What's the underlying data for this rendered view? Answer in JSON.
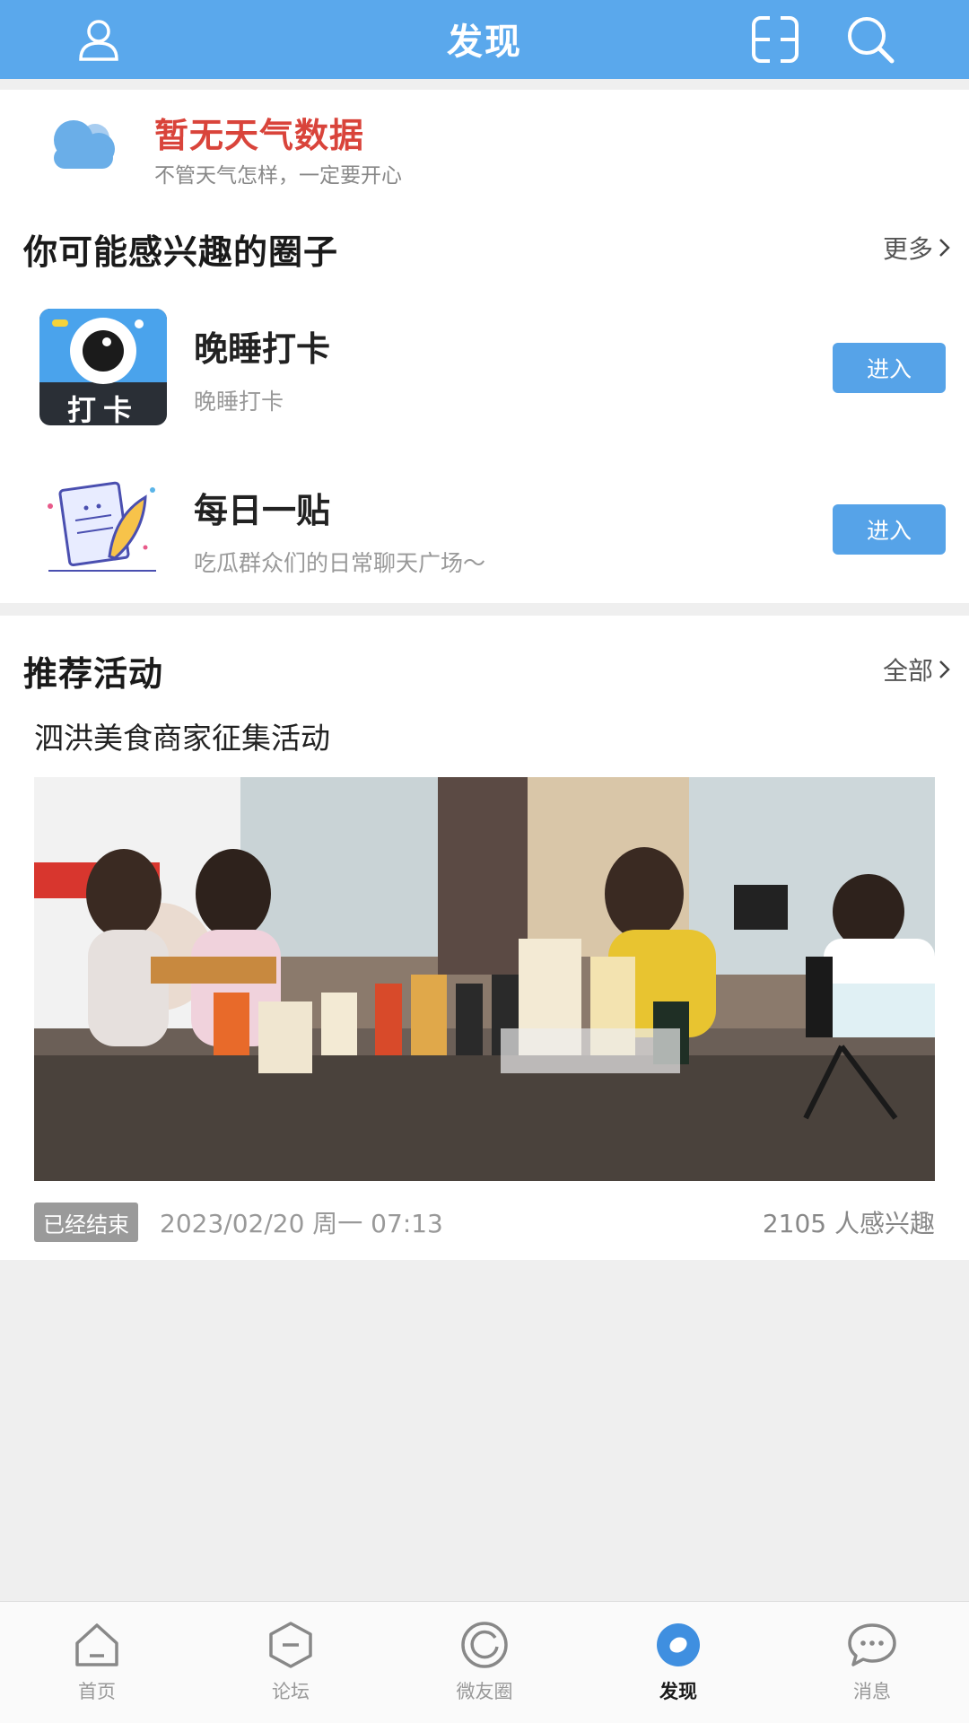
{
  "header": {
    "title": "发现"
  },
  "weather": {
    "title": "暂无天气数据",
    "subtitle": "不管天气怎样，一定要开心"
  },
  "circles": {
    "title": "你可能感兴趣的圈子",
    "more_label": "更多",
    "items": [
      {
        "name": "晚睡打卡",
        "desc": "晚睡打卡",
        "thumb_text": "打卡",
        "enter_label": "进入"
      },
      {
        "name": "每日一贴",
        "desc": "吃瓜群众们的日常聊天广场～",
        "enter_label": "进入"
      }
    ]
  },
  "activities": {
    "title": "推荐活动",
    "more_label": "全部",
    "items": [
      {
        "name": "泗洪美食商家征集活动",
        "status": "已经结束",
        "date": "2023/02/20 周一 07:13",
        "interest": "2105 人感兴趣"
      }
    ]
  },
  "tabbar": {
    "items": [
      {
        "label": "首页",
        "icon": "home-icon"
      },
      {
        "label": "论坛",
        "icon": "forum-icon"
      },
      {
        "label": "微友圈",
        "icon": "moments-icon"
      },
      {
        "label": "发现",
        "icon": "discover-icon",
        "active": true
      },
      {
        "label": "消息",
        "icon": "message-icon"
      }
    ]
  },
  "colors": {
    "accent": "#5aa8ec",
    "button": "#56a3e8",
    "weather_title": "#d9443b"
  }
}
